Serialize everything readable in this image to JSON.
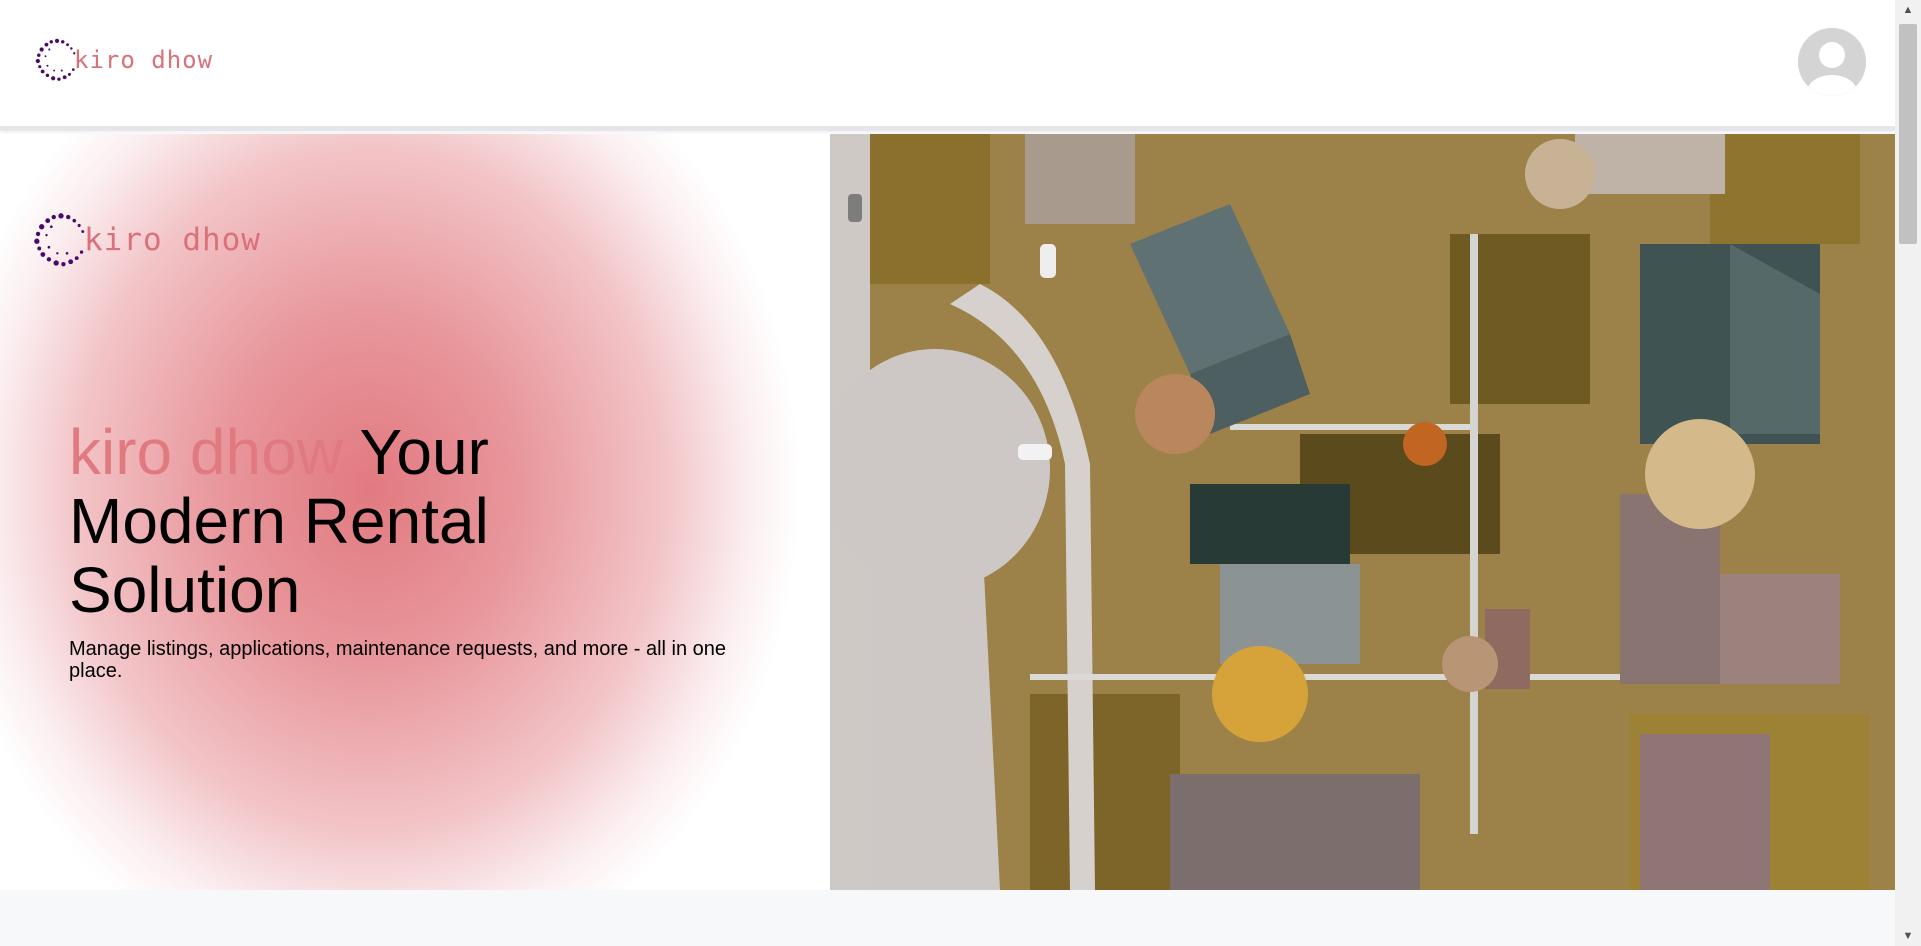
{
  "header": {
    "logo_text": "kiro dhow",
    "avatar_icon": "user-avatar-icon"
  },
  "hero": {
    "logo_text": "kiro dhow",
    "headline_brand": "kiro dhow",
    "headline_rest": " Your Modern Rental Solution",
    "subtext": "Manage listings, applications, maintenance requests, and more - all in one place.",
    "image_icon": "aerial-neighborhood-photo"
  },
  "colors": {
    "brand": "#e17a80",
    "logo_dots": "#4a0a6b",
    "text": "#000000"
  },
  "scrollbar": {
    "up_glyph": "▲",
    "down_glyph": "▼"
  }
}
